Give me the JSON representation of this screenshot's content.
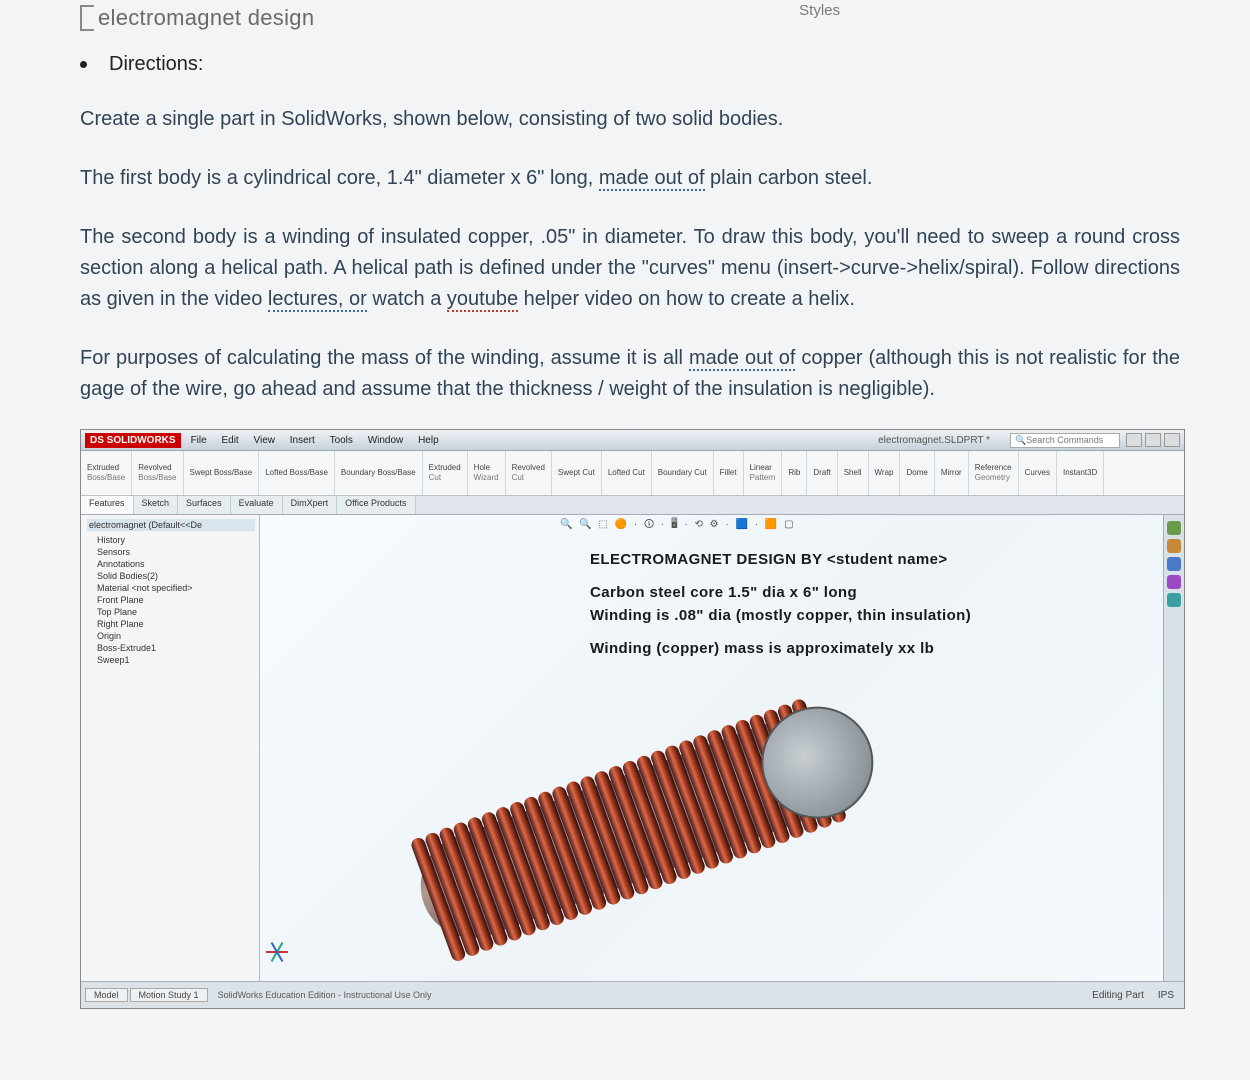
{
  "header": {
    "partial_title": "electromagnet design",
    "styles_label": "Styles"
  },
  "doc": {
    "directions_label": "Directions:",
    "p1": "Create a single part in SolidWorks, shown below, consisting of two solid bodies.",
    "p2_a": "The first body is a cylindrical core, 1.4\" diameter x 6\" long, ",
    "p2_u": "made out of",
    "p2_b": " plain carbon steel.",
    "p3_a": "The second body is a winding of insulated copper, .05\" in diameter. To draw this body, you'll need to sweep a round cross section along a helical path. A helical path is defined under the \"curves\" menu (insert->curve->helix/spiral). Follow directions as given in the video ",
    "p3_u1": "lectures, or",
    "p3_b": " watch a ",
    "p3_u2": "youtube",
    "p3_c": " helper video on how to create a helix.",
    "p4_a": "For purposes of calculating the mass of the winding, assume it is all ",
    "p4_u": "made out of",
    "p4_b": " copper (although this is not realistic for the gage of the wire, go ahead and assume that the thickness / weight of the insulation is negligible)."
  },
  "sw": {
    "logo": "DS SOLIDWORKS",
    "menu": [
      "File",
      "Edit",
      "View",
      "Insert",
      "Tools",
      "Window",
      "Help"
    ],
    "docname": "electromagnet.SLDPRT *",
    "search_placeholder": "Search Commands",
    "ribbon": [
      {
        "t": "Extruded",
        "s": "Boss/Base"
      },
      {
        "t": "Revolved",
        "s": "Boss/Base"
      },
      {
        "t": "Swept Boss/Base",
        "s": ""
      },
      {
        "t": "Lofted Boss/Base",
        "s": ""
      },
      {
        "t": "Boundary Boss/Base",
        "s": ""
      },
      {
        "t": "Extruded",
        "s": "Cut"
      },
      {
        "t": "Hole",
        "s": "Wizard"
      },
      {
        "t": "Revolved",
        "s": "Cut"
      },
      {
        "t": "Swept Cut",
        "s": ""
      },
      {
        "t": "Lofted Cut",
        "s": ""
      },
      {
        "t": "Boundary Cut",
        "s": ""
      },
      {
        "t": "Fillet",
        "s": ""
      },
      {
        "t": "Linear",
        "s": "Pattern"
      },
      {
        "t": "Rib",
        "s": ""
      },
      {
        "t": "Draft",
        "s": ""
      },
      {
        "t": "Shell",
        "s": ""
      },
      {
        "t": "Wrap",
        "s": ""
      },
      {
        "t": "Dome",
        "s": ""
      },
      {
        "t": "Mirror",
        "s": ""
      },
      {
        "t": "Reference",
        "s": "Geometry"
      },
      {
        "t": "Curves",
        "s": ""
      },
      {
        "t": "Instant3D",
        "s": ""
      }
    ],
    "cmd_tabs": [
      "Features",
      "Sketch",
      "Surfaces",
      "Evaluate",
      "DimXpert",
      "Office Products"
    ],
    "tree_header": "electromagnet (Default<<De",
    "tree": [
      "History",
      "Sensors",
      "Annotations",
      "Solid Bodies(2)",
      "Material <not specified>",
      "Front Plane",
      "Top Plane",
      "Right Plane",
      "Origin",
      "Boss-Extrude1",
      "Sweep1"
    ],
    "notes": {
      "l1": "ELECTROMAGNET DESIGN BY <student name>",
      "l2": "Carbon steel core 1.5\" dia x 6\" long",
      "l3": "Winding is .08\" dia (mostly copper, thin insulation)",
      "l4": "Winding (copper) mass is approximately xx lb"
    },
    "bottom_tabs": [
      "Model",
      "Motion Study 1"
    ],
    "edition": "SolidWorks Education Edition - Instructional Use Only",
    "status_right1": "Editing Part",
    "status_right2": "IPS"
  }
}
